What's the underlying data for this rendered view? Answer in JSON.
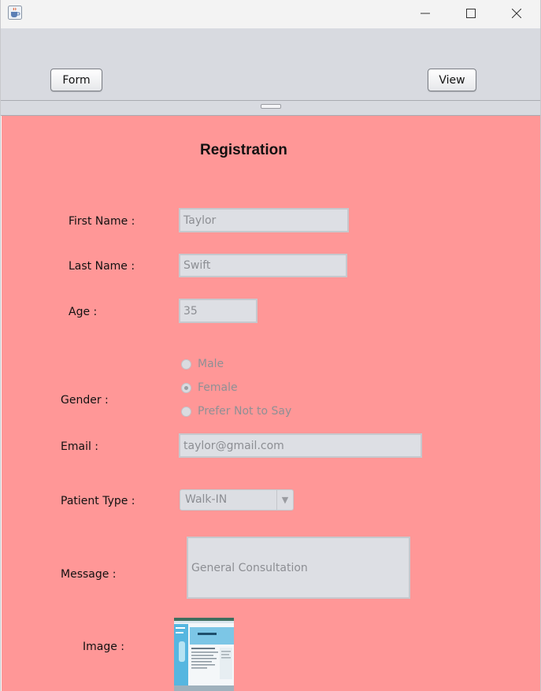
{
  "window": {
    "icons": {
      "app": "java-cup-icon",
      "minimize": "minimize-icon",
      "maximize": "maximize-icon",
      "close": "close-icon"
    }
  },
  "toolbar": {
    "form_label": "Form",
    "view_label": "View"
  },
  "form": {
    "title": "Registration",
    "first_name": {
      "label": "First Name :",
      "value": "Taylor"
    },
    "last_name": {
      "label": "Last Name :",
      "value": "Swift"
    },
    "age": {
      "label": "Age :",
      "value": "35"
    },
    "gender": {
      "label": "Gender :",
      "options": [
        "Male",
        "Female",
        "Prefer Not to Say"
      ],
      "selected": "Female"
    },
    "email": {
      "label": "Email :",
      "value": "taylor@gmail.com"
    },
    "patient_type": {
      "label": "Patient Type :",
      "value": "Walk-IN"
    },
    "message": {
      "label": "Message :",
      "value": "General Consultation"
    },
    "image": {
      "label": "Image :"
    }
  },
  "colors": {
    "panel_bg": "#ff9797",
    "toolbar_bg": "#d8dae0",
    "field_bg": "#dddfe4"
  }
}
